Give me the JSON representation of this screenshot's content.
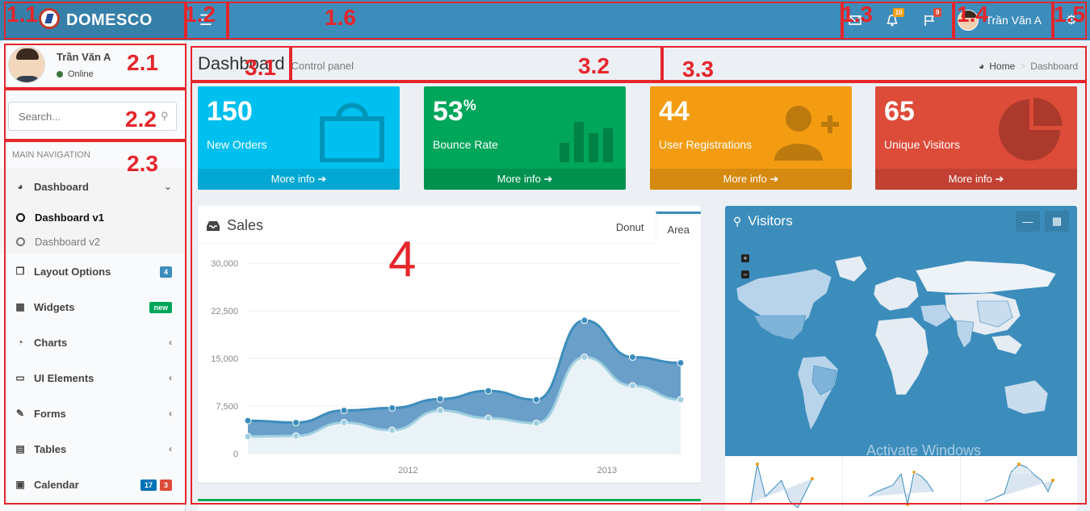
{
  "header": {
    "logo_text": "DOMESCO",
    "toggle_icon": "hamburger-icon",
    "notifications": [
      {
        "icon": "envelope-icon",
        "count": ""
      },
      {
        "icon": "bell-icon",
        "count": "10"
      },
      {
        "icon": "flag-icon",
        "count": "9"
      }
    ],
    "user_name": "Trần Văn A",
    "settings_icon": "gears-icon"
  },
  "sidebar": {
    "user_name": "Trần Văn A",
    "status": "Online",
    "search_placeholder": "Search...",
    "nav_header": "MAIN NAVIGATION",
    "items": [
      {
        "label": "Dashboard",
        "icon": "dashboard-icon"
      },
      {
        "label": "Layout Options",
        "icon": "files-icon",
        "badge": "4"
      },
      {
        "label": "Widgets",
        "icon": "th-icon",
        "badge": "new"
      },
      {
        "label": "Charts",
        "icon": "pie-chart-icon"
      },
      {
        "label": "UI Elements",
        "icon": "laptop-icon"
      },
      {
        "label": "Forms",
        "icon": "edit-icon"
      },
      {
        "label": "Tables",
        "icon": "table-icon"
      },
      {
        "label": "Calendar",
        "icon": "calendar-icon",
        "badge": "17",
        "badge2": "3"
      }
    ],
    "sub_items": [
      {
        "label": "Dashboard v1",
        "active": true
      },
      {
        "label": "Dashboard v2",
        "active": false
      }
    ]
  },
  "content_header": {
    "title": "Dashboard",
    "subtitle": "Control panel",
    "breadcrumb_home": "Home",
    "breadcrumb_current": "Dashboard"
  },
  "stat_boxes": [
    {
      "value": "150",
      "suffix": "",
      "label": "New Orders",
      "more": "More info",
      "color": "#00c0ef",
      "icon": "shopping-bag-icon"
    },
    {
      "value": "53",
      "suffix": "%",
      "label": "Bounce Rate",
      "more": "More info",
      "color": "#00a65a",
      "icon": "bar-chart-icon"
    },
    {
      "value": "44",
      "suffix": "",
      "label": "User Registrations",
      "more": "More info",
      "color": "#f39c12",
      "icon": "person-add-icon"
    },
    {
      "value": "65",
      "suffix": "",
      "label": "Unique Visitors",
      "more": "More info",
      "color": "#dd4b39",
      "icon": "pie-graph-icon"
    }
  ],
  "sales": {
    "title": "Sales",
    "tab_donut": "Donut",
    "tab_area": "Area"
  },
  "visitors": {
    "title": "Visitors",
    "zoom_in": "+",
    "zoom_out": "−"
  },
  "watermark": {
    "line1": "Activate Windows",
    "line2": "Go to Settings to activate Windows."
  },
  "annotations": [
    "1.1",
    "1.2",
    "1.6",
    "1.3",
    "1.4",
    "1.5",
    "2.1",
    "2.2",
    "2.3",
    "3.1",
    "3.2",
    "3.3",
    "4"
  ],
  "chart_data": {
    "type": "area",
    "title": "",
    "xlabel": "",
    "ylabel": "",
    "ylim": [
      0,
      30000
    ],
    "yticks": [
      "30,000",
      "22,500",
      "15,000",
      "7,500",
      "0"
    ],
    "xticks": [
      "2012",
      "2013"
    ],
    "series": [
      {
        "values": [
          5200,
          4900,
          6800,
          7200,
          8600,
          9900,
          8500,
          21000,
          15200,
          14300
        ],
        "color": "#3c8dbc"
      },
      {
        "values": [
          2700,
          2800,
          4900,
          3700,
          6800,
          5600,
          4800,
          15200,
          10700,
          8500
        ],
        "color": "#a0d0e0"
      }
    ]
  }
}
